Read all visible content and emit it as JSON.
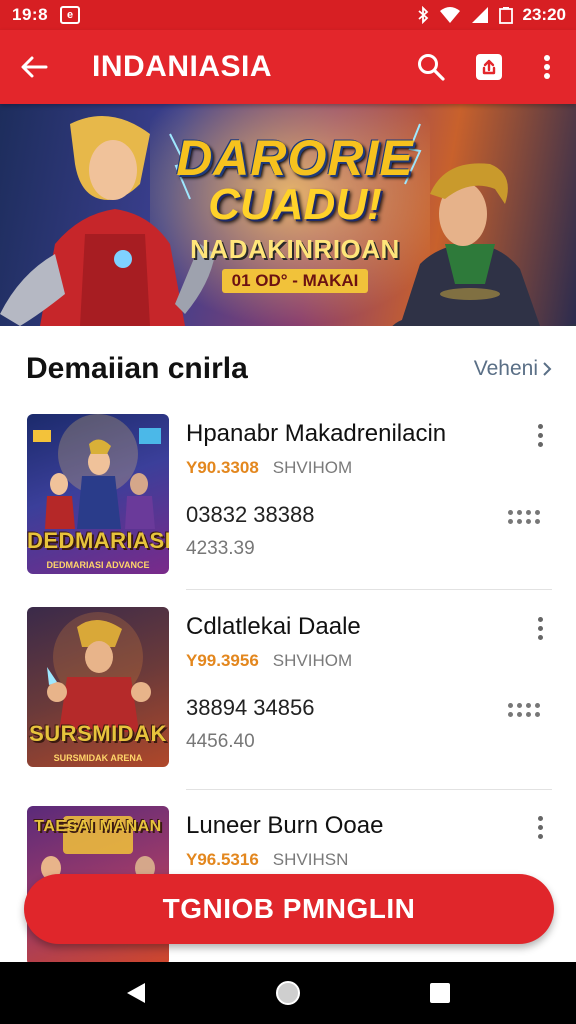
{
  "status_bar": {
    "time_left": "19:8",
    "notification_icon": "app-notification-icon",
    "time_right": "23:20"
  },
  "app_bar": {
    "title": "INDANIASIA"
  },
  "banner": {
    "line1": "DARORIE",
    "line2": "CUADU!",
    "line3": "NADAKINRIOAN",
    "line4": "01 OD° - MAKAI"
  },
  "section": {
    "title": "Demaiian cnirla",
    "more_label": "Veheni"
  },
  "items": [
    {
      "name": "Hpanabr Makadrenilacin",
      "price": "Y90.3308",
      "tag": "SHVIHOM",
      "stat": "03832 38388",
      "sub": "4233.39",
      "thumb_label": "DEDMARIASI",
      "thumb_sub": "DEDMARIASI ADVANCE",
      "thumb_colors": [
        "#1b2a6b",
        "#7a2a8a"
      ]
    },
    {
      "name": "Cdlatlekai Daale",
      "price": "Y99.3956",
      "tag": "SHVIHOM",
      "stat": "38894 34856",
      "sub": "4456.40",
      "thumb_label": "SURSMIDAK",
      "thumb_sub": "SURSMIDAK ARENA",
      "thumb_colors": [
        "#3a2a4a",
        "#b0482a"
      ]
    },
    {
      "name": "Luneer Burn Ooae",
      "price": "Y96.5316",
      "tag": "SHVIHSN",
      "stat": "",
      "sub": "",
      "thumb_label": "TAESAI MANAN",
      "thumb_sub": "",
      "thumb_colors": [
        "#5a2a7a",
        "#d0472a"
      ]
    }
  ],
  "cta": {
    "label": "TGNIOB PMNGLIN"
  },
  "colors": {
    "primary": "#e3262b",
    "status": "#d71f23",
    "accent_price": "#e3871e",
    "link": "#5a6f86"
  }
}
